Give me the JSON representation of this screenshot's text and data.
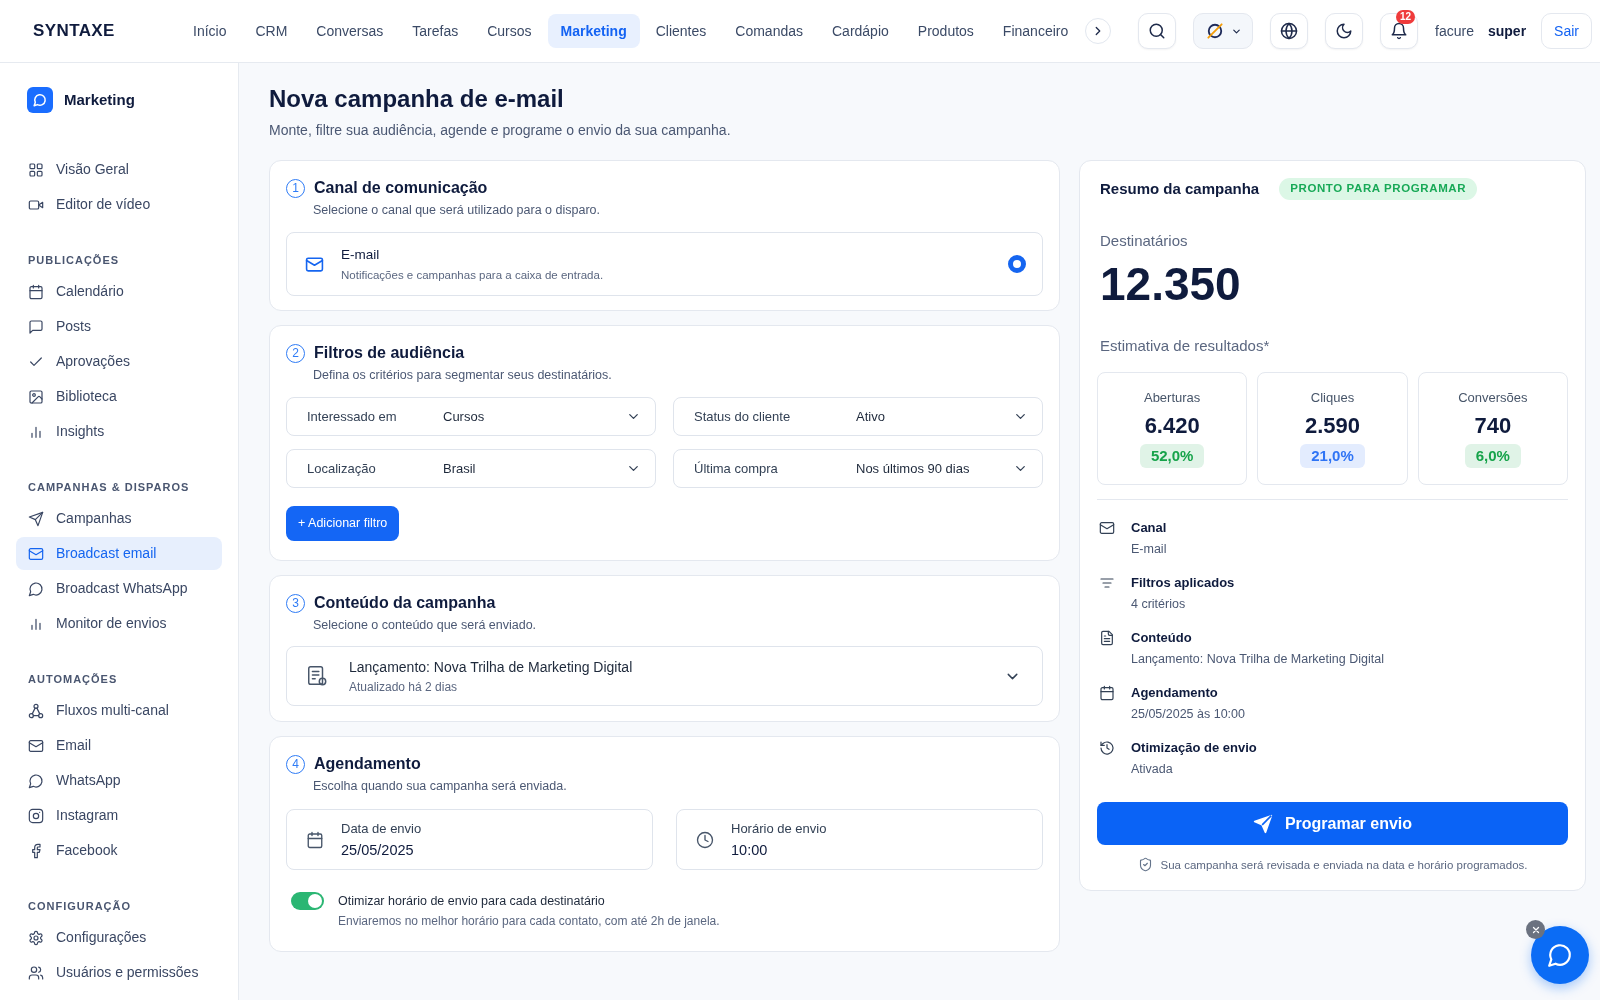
{
  "top_nav": {
    "logo": "SYNTAXE",
    "items": [
      {
        "label": "Início",
        "selected": false
      },
      {
        "label": "CRM",
        "selected": false
      },
      {
        "label": "Conversas",
        "selected": false
      },
      {
        "label": "Tarefas",
        "selected": false
      },
      {
        "label": "Cursos",
        "selected": false
      },
      {
        "label": "Marketing",
        "selected": true
      },
      {
        "label": "Clientes",
        "selected": false
      },
      {
        "label": "Comandas",
        "selected": false
      },
      {
        "label": "Cardápio",
        "selected": false
      },
      {
        "label": "Produtos",
        "selected": false
      },
      {
        "label": "Financeiro",
        "selected": false
      }
    ],
    "notification_count": "12",
    "user_name": "facure",
    "user_role": "super",
    "logout": "Sair"
  },
  "sidebar": {
    "title": "Marketing",
    "sections": [
      {
        "items": [
          {
            "label": "Visão Geral",
            "selected": false
          },
          {
            "label": "Editor de vídeo",
            "selected": false
          }
        ]
      },
      {
        "heading": "PUBLICAÇÕES",
        "items": [
          {
            "label": "Calendário",
            "selected": false
          },
          {
            "label": "Posts",
            "selected": false
          },
          {
            "label": "Aprovações",
            "selected": false
          },
          {
            "label": "Biblioteca",
            "selected": false
          },
          {
            "label": "Insights",
            "selected": false
          }
        ]
      },
      {
        "heading": "CAMPANHAS & DISPAROS",
        "items": [
          {
            "label": "Campanhas",
            "selected": false
          },
          {
            "label": "Broadcast email",
            "selected": true
          },
          {
            "label": "Broadcast WhatsApp",
            "selected": false
          },
          {
            "label": "Monitor de envios",
            "selected": false
          }
        ]
      },
      {
        "heading": "AUTOMAÇÕES",
        "items": [
          {
            "label": "Fluxos multi-canal",
            "selected": false
          },
          {
            "label": "Email",
            "selected": false
          },
          {
            "label": "WhatsApp",
            "selected": false
          },
          {
            "label": "Instagram",
            "selected": false
          },
          {
            "label": "Facebook",
            "selected": false
          }
        ]
      },
      {
        "heading": "CONFIGURAÇÃO",
        "items": [
          {
            "label": "Configurações",
            "selected": false
          },
          {
            "label": "Usuários e permissões",
            "selected": false
          }
        ]
      }
    ]
  },
  "page": {
    "title": "Nova campanha de e-mail",
    "subtitle": "Monte, filtre sua audiência, agende e programe o envio da sua campanha."
  },
  "channel_step": {
    "number": "1",
    "title": "Canal de comunicação",
    "subtitle": "Selecione o canal que será utilizado para o disparo.",
    "options": [
      {
        "label": "E-mail",
        "description": "Notificações e campanhas para a caixa de entrada.",
        "selected": true
      }
    ]
  },
  "audience_step": {
    "number": "2",
    "title": "Filtros de audiência",
    "subtitle": "Defina os critérios para segmentar seus destinatários.",
    "filters": [
      {
        "label": "Interessado em",
        "value": "Cursos"
      },
      {
        "label": "Status do cliente",
        "value": "Ativo"
      },
      {
        "label": "Localização",
        "value": "Brasil"
      },
      {
        "label": "Última compra",
        "value": "Nos últimos 90 dias"
      }
    ],
    "add_button": "+ Adicionar filtro"
  },
  "content_step": {
    "number": "3",
    "title": "Conteúdo da campanha",
    "subtitle": "Selecione o conteúdo que será enviado.",
    "selected_content": {
      "title": "Lançamento: Nova Trilha de Marketing Digital",
      "updated": "Atualizado há 2 dias"
    }
  },
  "schedule_step": {
    "number": "4",
    "title": "Agendamento",
    "subtitle": "Escolha quando sua campanha será enviada.",
    "date": {
      "label": "Data de envio",
      "value": "25/05/2025"
    },
    "time": {
      "label": "Horário de envio",
      "value": "10:00"
    },
    "optimize": {
      "label": "Otimizar horário de envio para cada destinatário",
      "description": "Enviaremos no melhor horário para cada contato, com até 2h de janela.",
      "on": true
    }
  },
  "summary": {
    "title": "Resumo da campanha",
    "status_badge": "PRONTO PARA PROGRAMAR",
    "recipients_label": "Destinatários",
    "recipients": "12.350",
    "estimate_label": "Estimativa de resultados*",
    "metrics": [
      {
        "label": "Aberturas",
        "value": "6.420",
        "rate": "52,0%",
        "color": "#16a34a"
      },
      {
        "label": "Cliques",
        "value": "2.590",
        "rate": "21,0%",
        "color": "#2f74f5"
      },
      {
        "label": "Conversões",
        "value": "740",
        "rate": "6,0%",
        "color": "#16a34a"
      }
    ],
    "details": [
      {
        "label": "Canal",
        "value": "E-mail"
      },
      {
        "label": "Filtros aplicados",
        "value": "4 critérios"
      },
      {
        "label": "Conteúdo",
        "value": "Lançamento: Nova Trilha de Marketing Digital"
      },
      {
        "label": "Agendamento",
        "value": "25/05/2025 às 10:00"
      },
      {
        "label": "Otimização de envio",
        "value": "Ativada"
      }
    ],
    "submit_button": "Programar envio",
    "note": "Sua campanha será revisada e enviada na data e horário programados."
  }
}
